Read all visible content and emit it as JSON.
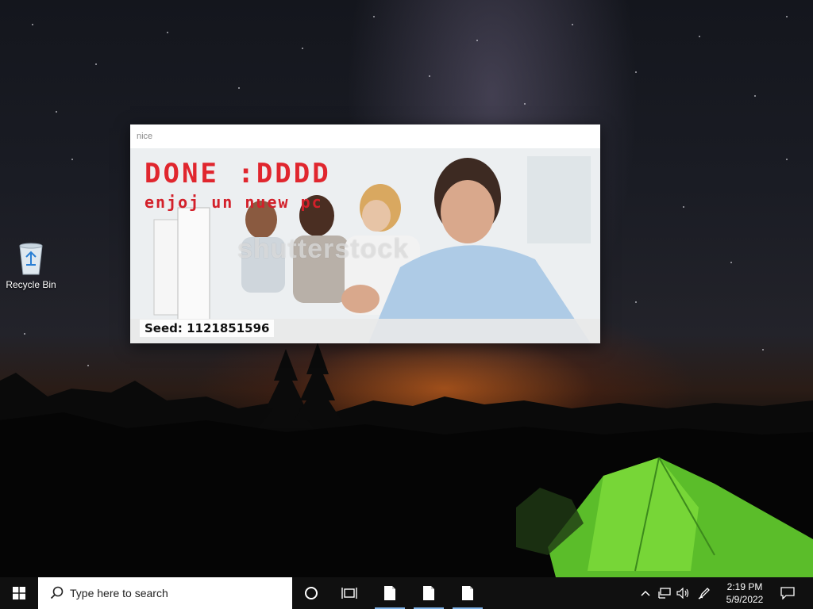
{
  "desktop": {
    "icons": [
      {
        "label": "Recycle Bin",
        "icon": "recycle-bin-icon"
      }
    ]
  },
  "window": {
    "title": "nice",
    "image": {
      "headline": "DONE :DDDD",
      "subline": "enjoj un nuew pc",
      "watermark": "shutterstock",
      "seed_text": "Seed: 1121851596"
    }
  },
  "taskbar": {
    "start_icon": "windows-logo-icon",
    "search_placeholder": "Type here to search",
    "cortana_icon": "cortana-circle-icon",
    "task_view_icon": "task-view-icon",
    "pinned_apps": [
      {
        "icon": "document-icon",
        "active": true
      },
      {
        "icon": "document-icon",
        "active": true
      },
      {
        "icon": "document-icon",
        "active": true
      }
    ],
    "tray_icons": [
      "chevron-up-icon",
      "network-icon",
      "volume-icon",
      "pen-icon"
    ],
    "clock": {
      "time": "2:19 PM",
      "date": "5/9/2022"
    },
    "notification_icon": "action-center-icon"
  }
}
